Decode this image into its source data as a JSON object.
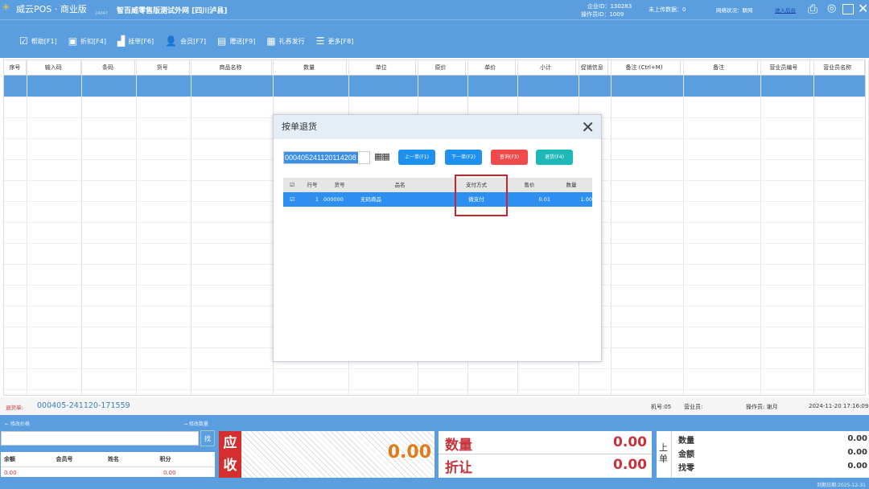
{
  "app": {
    "title": "威云POS · 商业版",
    "version": "24047",
    "store": "智百威零售版测试外网 [四川泸县]",
    "enterprise_label": "企业ID：",
    "enterprise_id": "130283",
    "operator_label": "操作员ID：",
    "operator_id": "1009",
    "unuploaded_label": "未上传数据：",
    "unuploaded": "0",
    "network_label": "网络状况：",
    "network": "联网",
    "backend_link": "进入后台"
  },
  "toolbar": [
    {
      "label": "帮助[F1]",
      "icon": "edit-icon"
    },
    {
      "label": "折扣[F4]",
      "icon": "discount-icon"
    },
    {
      "label": "挂单[F6]",
      "icon": "chart-icon"
    },
    {
      "label": "会员[F7]",
      "icon": "user-icon"
    },
    {
      "label": "赠送[F9]",
      "icon": "gift-icon"
    },
    {
      "label": "礼券发行",
      "icon": "coupon-icon"
    },
    {
      "label": "更多[F8]",
      "icon": "menu-icon"
    }
  ],
  "columns": [
    "序号",
    "输入码",
    "条码",
    "货号",
    "商品名称",
    "数量",
    "单位",
    "原价",
    "单价",
    "小计",
    "促销信息",
    "备注 (Ctrl+M)",
    "备注",
    "营业员编号",
    "营业员名称"
  ],
  "dialog": {
    "title": "按单退货",
    "order_no": "000405241120114208",
    "buttons": {
      "prev": "上一单(F1)",
      "next": "下一单(F2)",
      "query": "查询(F3)",
      "return": "退货(F4)"
    },
    "columns": [
      "行号",
      "货号",
      "品名",
      "支付方式",
      "售价",
      "数量"
    ],
    "rows": [
      {
        "line": "1",
        "code": "000000",
        "name": "无码商品",
        "payment": "微支付",
        "price": "0.01",
        "qty": "1.00"
      }
    ]
  },
  "status": {
    "return_label": "退货单:",
    "return_no": "000405-241120-171559",
    "machine": "机号:05",
    "clerk": "营业员:",
    "operator": "操作员: 谢月",
    "datetime": "2024-11-20 17:16:09"
  },
  "bottom": {
    "edit_price": "← 修改价格",
    "edit_qty": "→ 修改数量",
    "search_btn": "找",
    "member_cols": [
      "余额",
      "会员号",
      "姓名",
      "积分"
    ],
    "member_vals": {
      "balance": "0.00",
      "points": "0.00"
    },
    "receivable_label": "应收",
    "receivable": "0.00",
    "qty_label": "数量",
    "qty": "0.00",
    "discount_label": "折让",
    "discount": "0.00",
    "prev_label": "上单",
    "prev_qty_label": "数量",
    "prev_qty": "0.00",
    "prev_amount_label": "金额",
    "prev_amount": "0.00",
    "prev_change_label": "找零",
    "prev_change": "0.00",
    "expiry": "到期日期:2025-12-31"
  }
}
